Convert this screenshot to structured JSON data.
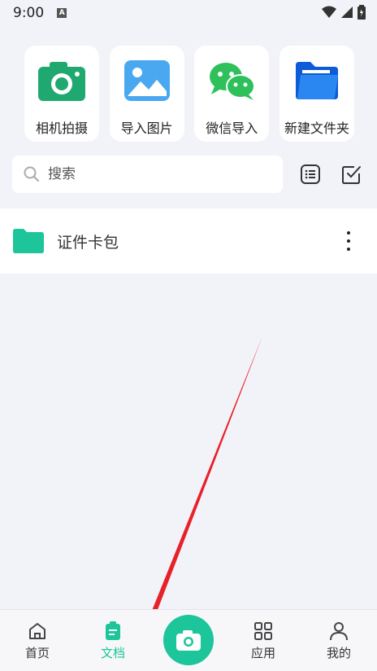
{
  "status_bar": {
    "time": "9:00",
    "notif_letter": "A"
  },
  "quick_actions": [
    {
      "label": "相机拍摄",
      "icon": "camera-icon"
    },
    {
      "label": "导入图片",
      "icon": "image-icon"
    },
    {
      "label": "微信导入",
      "icon": "wechat-icon"
    },
    {
      "label": "新建文件夹",
      "icon": "folder-icon"
    }
  ],
  "search": {
    "placeholder": "搜索"
  },
  "folders": [
    {
      "name": "证件卡包"
    }
  ],
  "bottom_nav": {
    "home": "首页",
    "docs": "文档",
    "apps": "应用",
    "mine": "我的"
  },
  "colors": {
    "accent": "#1cc59a",
    "arrow": "#e8202a",
    "background": "#f2f3f8"
  }
}
